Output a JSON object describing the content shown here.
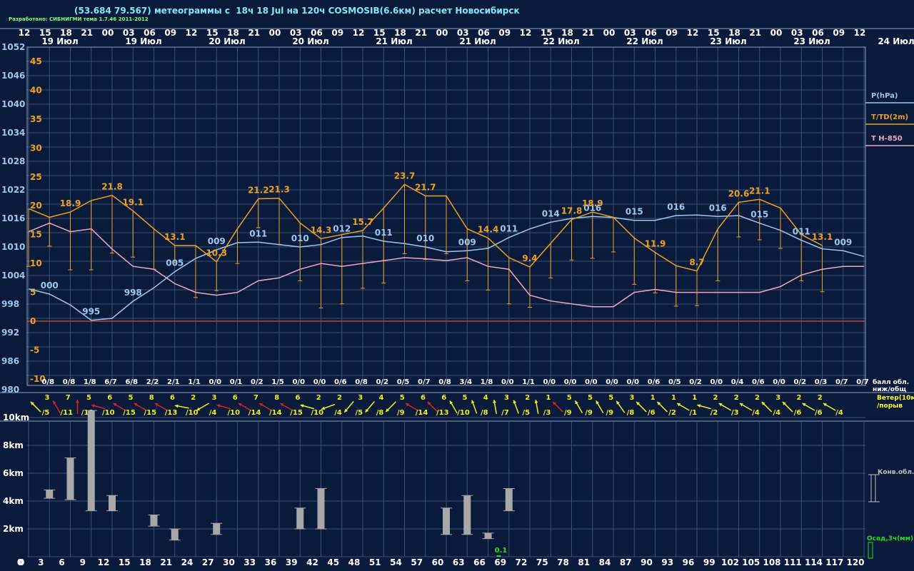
{
  "title": "(53.684 79.567) метеограммы с  18ч 18 Jul на 120ч COSMOSIB(6.6км) расчет Новосибирск",
  "credit": "Разработано: СИБНИГМИ тема 1.7.46 2011-2012",
  "colors": {
    "background": "#0a1a3a",
    "grid": "#3a5078",
    "pressure": "#9cc8f0",
    "temp": "#f0a020",
    "t850": "#f0a8c0",
    "zero": "#c04040",
    "wind_yellow": "#f0f020",
    "wind_red": "#e02020",
    "cloud_bar": "#a8a8a8",
    "precip": "#20e020",
    "label_white": "#ffffff",
    "legend_text": "#ffff20"
  },
  "header": {
    "hours": [
      "12",
      "15",
      "18",
      "21",
      "00",
      "03",
      "06",
      "09",
      "12",
      "15",
      "18",
      "21",
      "00",
      "03",
      "06",
      "09",
      "12",
      "15",
      "18",
      "21",
      "00",
      "03",
      "06",
      "09",
      "12",
      "15",
      "18",
      "21",
      "00",
      "03",
      "06",
      "09",
      "12",
      "15",
      "18",
      "21",
      "00",
      "03",
      "06",
      "09",
      "12"
    ],
    "dates": [
      "19 Июл",
      "19 Июл",
      "20 Июл",
      "20 Июл",
      "21 Июл",
      "21 Июл",
      "22 Июл",
      "22 Июл",
      "23 Июл",
      "23 Июл"
    ],
    "right_date": "24 Июл"
  },
  "legend": {
    "pressure": "P(hPa)",
    "temp": "T/TD(2m)",
    "t850": "T H-850",
    "clouds": "балл обл.\nниж/общ",
    "wind": "Ветер(10м)\n/порыв",
    "conv": "Конв.обл.",
    "precip": "Осад,3ч(мм)"
  },
  "chart_data": [
    {
      "type": "line",
      "title": "",
      "x_hours": [
        0,
        3,
        6,
        9,
        12,
        15,
        18,
        21,
        24,
        27,
        30,
        33,
        36,
        39,
        42,
        45,
        48,
        51,
        54,
        57,
        60,
        63,
        66,
        69,
        72,
        75,
        78,
        81,
        84,
        87,
        90,
        93,
        96,
        99,
        102,
        105,
        108,
        111,
        114,
        117,
        120
      ],
      "pressure_axis": {
        "ticks": [
          1052,
          1046,
          1040,
          1034,
          1028,
          1022,
          1016,
          1010,
          1004,
          998,
          992,
          986,
          980
        ],
        "unit": "hPa"
      },
      "temp_axis": {
        "ticks": [
          45,
          40,
          35,
          30,
          25,
          20,
          15,
          10,
          5,
          0,
          -5,
          -10
        ],
        "unit": "C"
      },
      "series": [
        {
          "name": "P(hPa)",
          "values": [
            1001.2,
            1000.1,
            997.8,
            994.6,
            995.0,
            998.6,
            1001.4,
            1004.8,
            1007.6,
            1009.4,
            1010.9,
            1011.0,
            1010.5,
            1010.0,
            1010.5,
            1012.0,
            1012.3,
            1011.2,
            1010.7,
            1010.0,
            1009.0,
            1009.2,
            1009.7,
            1012.0,
            1013.8,
            1015.2,
            1016.0,
            1016.4,
            1016.2,
            1015.6,
            1015.6,
            1016.6,
            1016.7,
            1016.4,
            1016.6,
            1015.0,
            1013.5,
            1011.4,
            1009.6,
            1009.2,
            1008.0
          ],
          "point_labels": {
            "1": "000",
            "3": "995",
            "5": "998",
            "7": "005",
            "9": "009",
            "11": "011",
            "13": "010",
            "15": "012",
            "17": "011",
            "19": "010",
            "21": "009",
            "23": "011",
            "25": "014",
            "27": "016",
            "29": "015",
            "31": "016",
            "33": "016",
            "35": "015",
            "37": "011",
            "39": "009"
          }
        },
        {
          "name": "T/TD(2m)",
          "values": [
            19.5,
            18.0,
            18.9,
            20.9,
            21.8,
            19.1,
            16.0,
            13.1,
            13.1,
            10.3,
            16.0,
            21.2,
            21.3,
            17.0,
            14.3,
            15.0,
            15.7,
            19.6,
            23.7,
            21.7,
            21.7,
            16.0,
            14.4,
            11.0,
            9.4,
            13.5,
            17.6,
            18.9,
            18.0,
            14.4,
            11.9,
            9.6,
            8.7,
            16.0,
            20.6,
            21.1,
            19.6,
            15.0,
            13.1
          ],
          "x_hours": [
            0,
            3,
            6,
            9,
            12,
            15,
            18,
            21,
            24,
            27,
            30,
            33,
            36,
            39,
            42,
            45,
            48,
            51,
            54,
            57,
            60,
            63,
            66,
            69,
            72,
            75,
            78,
            81,
            84,
            87,
            90,
            93,
            96,
            99,
            102,
            105,
            108,
            111,
            114
          ],
          "point_labels": {
            "2": "18.9",
            "4": "21.8",
            "5": "19.1",
            "7": "13.1",
            "9": "10.3",
            "11": "21.2",
            "12": "21.3",
            "14": "14.3",
            "16": "15.7",
            "18": "23.7",
            "19": "21.7",
            "22": "14.4",
            "24": "9.4",
            "26": "17.8",
            "27": "18.9",
            "30": "11.9",
            "32": "8.7",
            "34": "20.6",
            "35": "21.1",
            "38": "13.1"
          }
        },
        {
          "name": "T H-850",
          "values": [
            15.5,
            17.0,
            15.5,
            16.0,
            12.5,
            9.5,
            9.0,
            6.5,
            5.0,
            4.5,
            5.0,
            7.0,
            7.5,
            9.0,
            10.0,
            9.5,
            10.0,
            10.5,
            11.0,
            10.8,
            10.5,
            11.0,
            9.5,
            9.0,
            4.5,
            3.5,
            3.0,
            2.5,
            2.5,
            5.0,
            5.5,
            5.0,
            5.0,
            5.0,
            5.0,
            5.0,
            6.0,
            8.0,
            9.0,
            9.5,
            9.5
          ]
        }
      ]
    },
    {
      "type": "table",
      "title": "балл обл. ниж/общ",
      "values": [
        "0/8",
        "0/8",
        "1/8",
        "6/7",
        "6/8",
        "2/2",
        "2/1",
        "1/1",
        "0/0",
        "0/1",
        "0/2",
        "1/5",
        "0/0",
        "0/0",
        "0/6",
        "0/8",
        "0/2",
        "0/5",
        "0/7",
        "0/8",
        "3/4",
        "1/8",
        "0/0",
        "1/1",
        "0/0",
        "0/0",
        "0/0",
        "0/0",
        "0/0",
        "0/6",
        "0/5",
        "0/2",
        "0/0",
        "0/4",
        "0/6",
        "0/0",
        "0/2",
        "0/3",
        "0/7",
        "0/7"
      ]
    },
    {
      "type": "table",
      "title": "Ветер(10м)/порыв",
      "speed": [
        "3",
        "7",
        "5",
        "6",
        "5",
        "8",
        "6",
        "2",
        "3",
        "6",
        "7",
        "8",
        "6",
        "2",
        "2",
        "3",
        "4",
        "5",
        "6",
        "6",
        "5",
        "4",
        "3",
        "2",
        "1",
        "5",
        "5",
        "5",
        "3",
        "1",
        "1",
        "1",
        "2",
        "2",
        "2",
        "3",
        "2",
        "2"
      ],
      "gust": [
        "/5",
        "/11",
        "/12",
        "/10",
        "/15",
        "/15",
        "/13",
        "/10",
        "/4",
        "/10",
        "/14",
        "/14",
        "/15",
        "/10",
        "/4",
        "/5",
        "/8",
        "/9",
        "/14",
        "/13",
        "/10",
        "/8",
        "/7",
        "/5",
        "/3",
        "/9",
        "/9",
        "/9",
        "/8",
        "/6",
        "/2",
        "/1",
        "/2",
        "/3",
        "/4",
        "/4",
        "/6",
        "/6",
        "/4"
      ],
      "direction_deg": [
        315,
        330,
        0,
        285,
        300,
        300,
        300,
        280,
        240,
        285,
        300,
        300,
        300,
        285,
        250,
        220,
        220,
        225,
        300,
        315,
        330,
        340,
        350,
        340,
        350,
        315,
        330,
        330,
        325,
        315,
        315,
        300,
        285,
        300,
        300,
        315,
        315,
        300,
        300,
        240
      ],
      "strong": [
        false,
        true,
        true,
        true,
        true,
        true,
        true,
        false,
        false,
        true,
        true,
        true,
        true,
        false,
        false,
        false,
        false,
        false,
        true,
        true,
        false,
        false,
        false,
        false,
        false,
        true,
        false,
        false,
        false,
        false,
        false,
        false,
        false,
        false,
        false,
        false,
        false,
        false,
        false,
        false
      ]
    },
    {
      "type": "bar",
      "title": "Конв.обл.",
      "yticks": [
        "10km",
        "8km",
        "6km",
        "4km",
        "2km",
        "0"
      ],
      "bars": [
        {
          "hour": 3,
          "base_km": 4.2,
          "top_km": 4.8
        },
        {
          "hour": 6,
          "base_km": 4.1,
          "top_km": 7.1
        },
        {
          "hour": 9,
          "base_km": 3.3,
          "top_km": 10.5
        },
        {
          "hour": 12,
          "base_km": 3.3,
          "top_km": 4.4
        },
        {
          "hour": 18,
          "base_km": 2.2,
          "top_km": 3.0
        },
        {
          "hour": 21,
          "base_km": 1.2,
          "top_km": 2.0
        },
        {
          "hour": 27,
          "base_km": 1.6,
          "top_km": 2.4
        },
        {
          "hour": 39,
          "base_km": 2.0,
          "top_km": 3.5
        },
        {
          "hour": 42,
          "base_km": 2.0,
          "top_km": 4.9
        },
        {
          "hour": 60,
          "base_km": 1.6,
          "top_km": 3.5
        },
        {
          "hour": 63,
          "base_km": 1.6,
          "top_km": 4.4
        },
        {
          "hour": 66,
          "base_km": 1.3,
          "top_km": 1.7
        },
        {
          "hour": 69,
          "base_km": 3.3,
          "top_km": 4.9
        }
      ],
      "precip_label": "0.1",
      "precip_hour": 66,
      "xticks": [
        "0",
        "3",
        "6",
        "9",
        "12",
        "15",
        "18",
        "21",
        "24",
        "27",
        "30",
        "33",
        "36",
        "39",
        "42",
        "45",
        "48",
        "51",
        "54",
        "57",
        "60",
        "63",
        "66",
        "69",
        "72",
        "75",
        "78",
        "81",
        "84",
        "87",
        "90",
        "93",
        "96",
        "99",
        "102",
        "105",
        "108",
        "111",
        "114",
        "117",
        "120"
      ]
    }
  ]
}
